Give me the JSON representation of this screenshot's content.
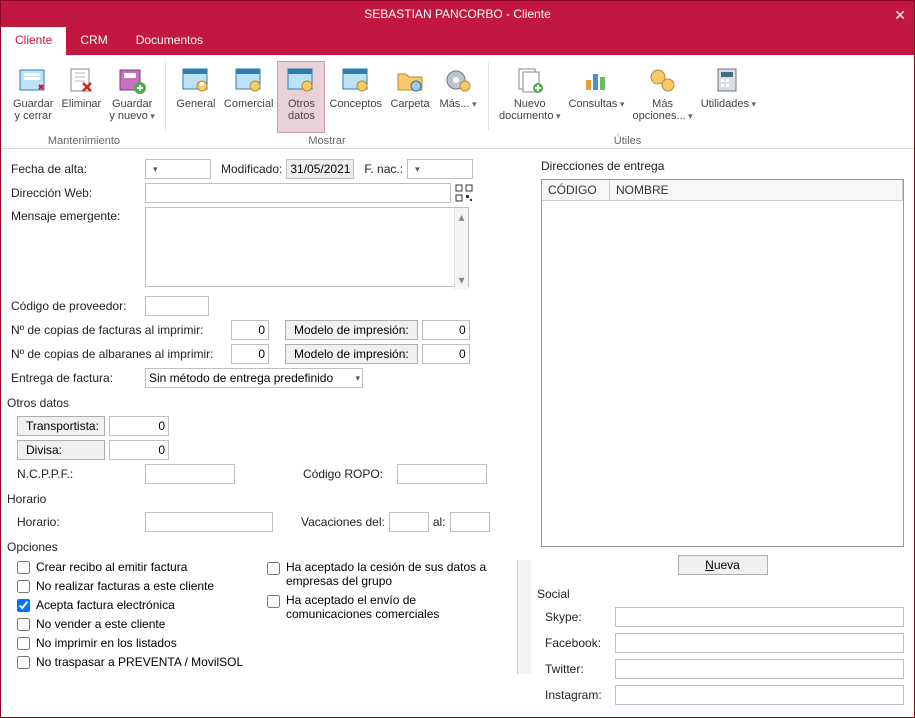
{
  "window": {
    "title": "SEBASTIAN PANCORBO - Cliente"
  },
  "tabs": {
    "cliente": "Cliente",
    "crm": "CRM",
    "documentos": "Documentos"
  },
  "ribbon": {
    "mantenimiento": {
      "label": "Mantenimiento",
      "guardar_cerrar": "Guardar\ny cerrar",
      "eliminar": "Eliminar",
      "guardar_nuevo": "Guardar\ny nuevo"
    },
    "mostrar": {
      "label": "Mostrar",
      "general": "General",
      "comercial": "Comercial",
      "otros_datos": "Otros\ndatos",
      "conceptos": "Conceptos",
      "carpeta": "Carpeta",
      "mas": "Más..."
    },
    "utiles": {
      "label": "Útiles",
      "nuevo_doc": "Nuevo\ndocumento",
      "consultas": "Consultas",
      "mas_opciones": "Más\nopciones...",
      "utilidades": "Utilidades"
    }
  },
  "fields": {
    "fecha_alta_lbl": "Fecha de alta:",
    "modificado_lbl": "Modificado:",
    "modificado_val": "31/05/2021",
    "fnac_lbl": "F. nac.:",
    "direccion_web_lbl": "Dirección Web:",
    "mensaje_emergente_lbl": "Mensaje emergente:",
    "codigo_proveedor_lbl": "Código de proveedor:",
    "n_copias_facturas_lbl": "Nº de copias de facturas al imprimir:",
    "n_copias_facturas_val": "0",
    "n_copias_albaranes_lbl": "Nº de copias de albaranes al imprimir:",
    "n_copias_albaranes_val": "0",
    "modelo_impresion_lbl": "Modelo de impresión:",
    "modelo_impresion_val1": "0",
    "modelo_impresion_val2": "0",
    "entrega_factura_lbl": "Entrega de factura:",
    "entrega_factura_sel": "Sin método de entrega predefinido"
  },
  "otros_datos": {
    "title": "Otros datos",
    "transportista_lbl": "Transportista:",
    "transportista_val": "0",
    "divisa_lbl": "Divisa:",
    "divisa_val": "0",
    "ncppf_lbl": "N.C.P.P.F.:",
    "codigo_ropo_lbl": "Código ROPO:"
  },
  "horario": {
    "title": "Horario",
    "horario_lbl": "Horario:",
    "vacaciones_del_lbl": "Vacaciones del:",
    "al_lbl": "al:"
  },
  "opciones": {
    "title": "Opciones",
    "crear_recibo": "Crear recibo al emitir factura",
    "no_facturas": "No realizar facturas a este cliente",
    "acepta_fe": "Acepta factura electrónica",
    "no_vender": "No vender a este cliente",
    "no_imprimir": "No imprimir en los listados",
    "no_traspasar": "No traspasar a PREVENTA / MovilSOL",
    "cesion_datos": "Ha aceptado la cesión de sus datos a empresas del grupo",
    "comunicaciones": "Ha aceptado el envío de comunicaciones comerciales"
  },
  "direcciones": {
    "title": "Direcciones de entrega",
    "col_codigo": "CÓDIGO",
    "col_nombre": "NOMBRE",
    "nueva": "Nueva"
  },
  "social": {
    "title": "Social",
    "skype": "Skype:",
    "facebook": "Facebook:",
    "twitter": "Twitter:",
    "instagram": "Instagram:"
  }
}
